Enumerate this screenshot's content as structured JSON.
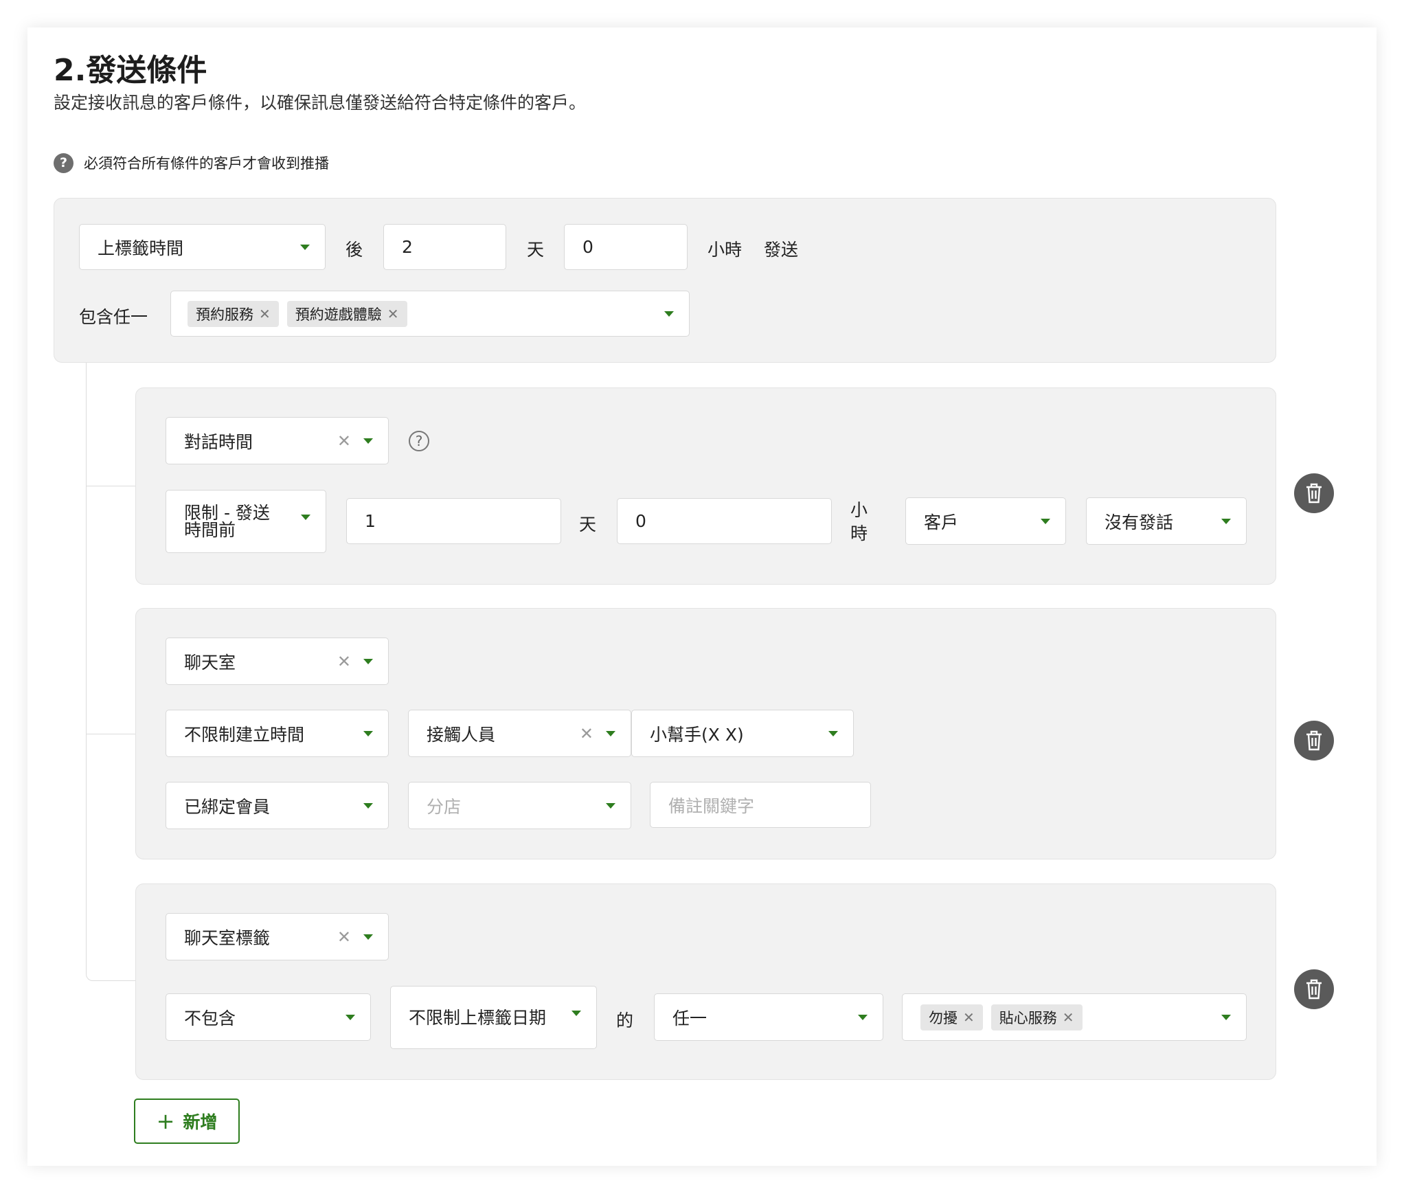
{
  "section": {
    "title": "2.發送條件",
    "description": "設定接收訊息的客戶條件，以確保訊息僅發送給符合特定條件的客戶。",
    "note_icon": "?",
    "note": "必須符合所有條件的客戶才會收到推播"
  },
  "main_condition": {
    "time_field": "上標籤時間",
    "after_label": "後",
    "days_value": "2",
    "days_unit": "天",
    "hours_value": "0",
    "hours_unit": "小時",
    "send_label": "發送",
    "include_label": "包含任一",
    "tags": [
      "預約服務",
      "預約遊戲體驗"
    ]
  },
  "conditions": [
    {
      "type": "對話時間",
      "help_icon": "?",
      "limit": "限制 - 發送時間前",
      "days_value": "1",
      "days_unit": "天",
      "hours_value": "0",
      "hours_unit": "小時",
      "party": "客戶",
      "action": "沒有發話"
    },
    {
      "type": "聊天室",
      "created_time": "不限制建立時間",
      "contact_field": "接觸人員",
      "contact_value": "小幫手(X X)",
      "member_status": "已綁定會員",
      "branch_placeholder": "分店",
      "note_keyword_placeholder": "備註關鍵字"
    },
    {
      "type": "聊天室標籤",
      "operator": "不包含",
      "date_limit": "不限制上標籤日期",
      "of_label": "的",
      "match": "任一",
      "tags": [
        "勿擾",
        "貼心服務"
      ]
    }
  ],
  "add_button": {
    "icon": "plus-icon",
    "label": "新增"
  },
  "colors": {
    "accent": "#2e7d1f",
    "panel_bg": "#f2f2f2",
    "trash_bg": "#5a5a5a"
  }
}
